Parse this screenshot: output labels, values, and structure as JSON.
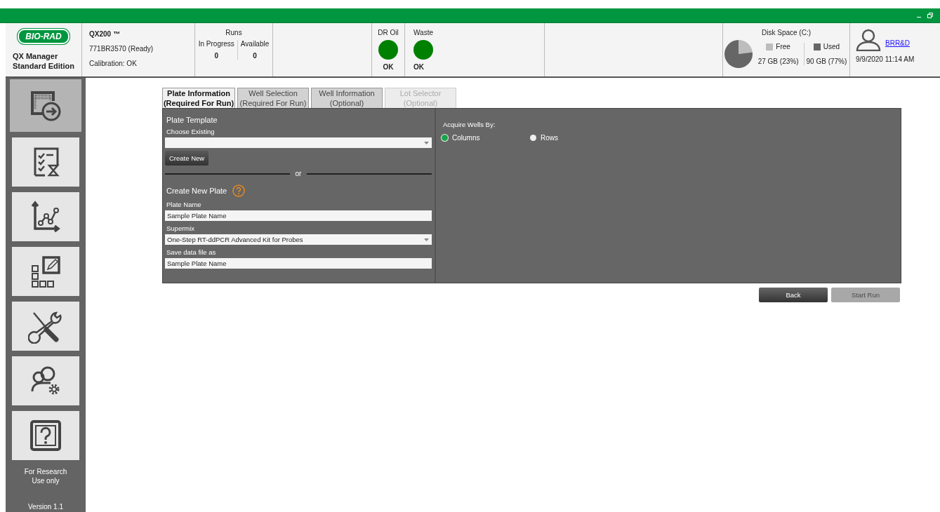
{
  "header": {
    "logo": "BIO-RAD",
    "app_name": [
      "QX Manager",
      "Standard Edition"
    ],
    "instrument": {
      "name": "QX200 ™",
      "status": "771BR3570 (Ready)",
      "calibration": "Calibration: OK"
    },
    "runs": {
      "title": "Runs",
      "columns": [
        {
          "label": "In Progress",
          "value": "0"
        },
        {
          "label": "Available",
          "value": "0"
        }
      ]
    },
    "indicators": [
      {
        "label": "DR Oil",
        "status": "OK",
        "color": "#008000"
      },
      {
        "label": "Waste",
        "status": "OK",
        "color": "#008000"
      }
    ],
    "disk": {
      "title": "Disk Space (C:)",
      "legend": [
        {
          "value": "27 GB (23%)",
          "color": "#bdbdbd"
        },
        {
          "value": "90 GB (77%)",
          "color": "#666666"
        }
      ],
      "chart_data": {
        "type": "pie",
        "categories": [
          "Free",
          "Used"
        ],
        "values": [
          23,
          77
        ]
      }
    },
    "user": {
      "name": "BRR&D",
      "datetime": "9/9/2020 11:14 AM"
    }
  },
  "sidebar": {
    "items": [
      {
        "kind": "run",
        "selected": true
      },
      {
        "kind": "checklist",
        "selected": false
      },
      {
        "kind": "analysis",
        "selected": false
      },
      {
        "kind": "editor",
        "selected": false
      },
      {
        "kind": "tools",
        "selected": false
      },
      {
        "kind": "users",
        "selected": false
      },
      {
        "kind": "help",
        "selected": false
      }
    ],
    "footer": "For Research Use only",
    "version": "Version 1.1"
  },
  "tabs": [
    {
      "title": "Plate Information",
      "subtitle": "(Required For Run)",
      "selected": true,
      "disabled": false
    },
    {
      "title": "Well Selection",
      "subtitle": "(Required For Run)",
      "selected": false,
      "disabled": false
    },
    {
      "title": "Well Information",
      "subtitle": "(Optional)",
      "selected": false,
      "disabled": false
    },
    {
      "title": "Lot Selector",
      "subtitle": "(Optional)",
      "selected": false,
      "disabled": true
    }
  ],
  "form": {
    "section_title": "Plate Template",
    "choose_label": "Choose Existing",
    "create_button": "Create New",
    "divider_text": "or",
    "new_plate_title": "Create New Plate",
    "fields": [
      {
        "label": "Plate Name",
        "value": "Sample Plate Name",
        "kind": "text"
      },
      {
        "label": "Supermix",
        "value": "One-Step RT-ddPCR Advanced Kit for Probes",
        "kind": "dropdown"
      },
      {
        "label": "Save data file as",
        "value": "Sample Plate Name",
        "kind": "text"
      }
    ]
  },
  "acquire": {
    "title": "Acquire Wells By:",
    "options": [
      {
        "label": "Columns",
        "selected": true
      },
      {
        "label": "Rows",
        "selected": false
      }
    ]
  },
  "buttons": [
    {
      "label": "Back",
      "disabled": false
    },
    {
      "label": "Start Run",
      "disabled": true
    }
  ]
}
